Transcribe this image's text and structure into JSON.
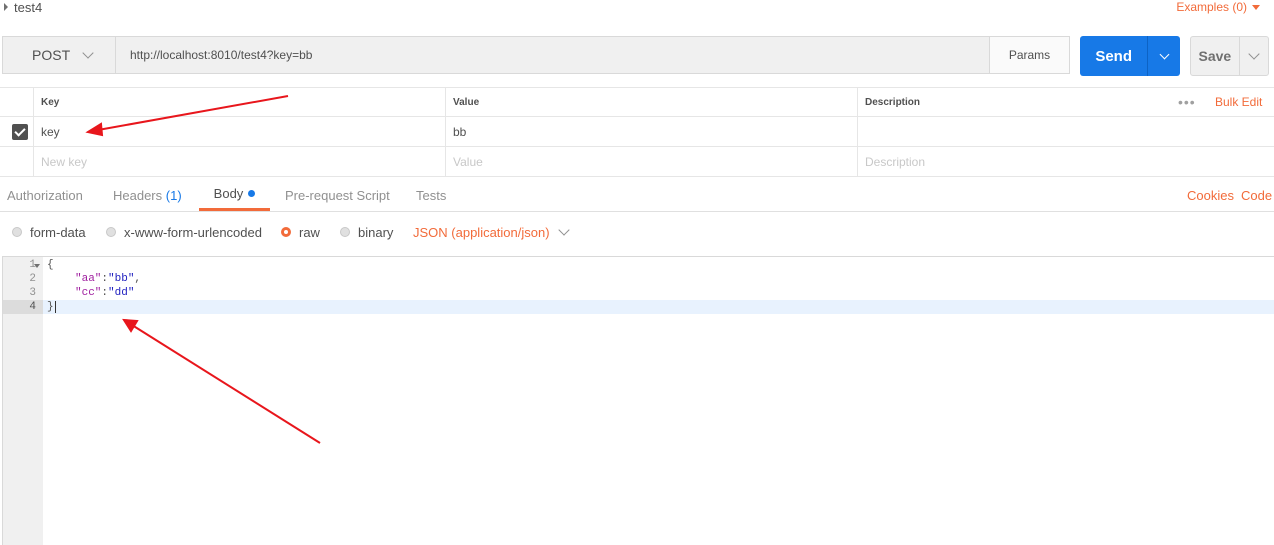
{
  "request": {
    "name": "test4",
    "examples_label": "Examples (0)",
    "method": "POST",
    "url": "http://localhost:8010/test4?key=bb",
    "params_label": "Params",
    "send_label": "Send",
    "save_label": "Save"
  },
  "params_table": {
    "headers": {
      "key": "Key",
      "value": "Value",
      "description": "Description"
    },
    "more_label": "•••",
    "bulk_edit_label": "Bulk Edit",
    "rows": [
      {
        "checked": true,
        "key": "key",
        "value": "bb",
        "description": ""
      }
    ],
    "placeholders": {
      "key": "New key",
      "value": "Value",
      "description": "Description"
    }
  },
  "tabs": {
    "authorization": "Authorization",
    "headers_label": "Headers",
    "headers_count": "(1)",
    "body": "Body",
    "prerequest": "Pre-request Script",
    "tests": "Tests",
    "active": "Body",
    "cookies": "Cookies",
    "code": "Code"
  },
  "body_types": {
    "form_data": "form-data",
    "urlencoded": "x-www-form-urlencoded",
    "raw": "raw",
    "binary": "binary",
    "selected": "raw",
    "content_type": "JSON (application/json)"
  },
  "editor": {
    "line_numbers": [
      "1",
      "2",
      "3",
      "4"
    ],
    "open_brace": "{",
    "close_brace": "}",
    "line2_key": "\"aa\"",
    "line2_value": "\"bb\"",
    "line3_key": "\"cc\"",
    "line3_value": "\"dd\"",
    "colon": ":",
    "comma": ","
  },
  "colors": {
    "accent": "#f26b3a",
    "primary": "#1779e7",
    "annotation_arrow": "#e8161c"
  }
}
